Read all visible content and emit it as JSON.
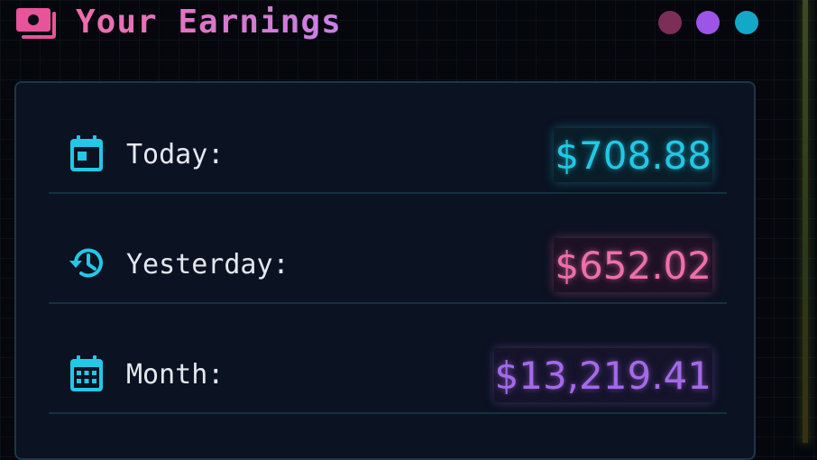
{
  "header": {
    "title": "Your Earnings",
    "icon": "money-icon",
    "window_dots": [
      {
        "name": "window-dot-magenta",
        "color": "#7c2e58"
      },
      {
        "name": "window-dot-purple",
        "color": "#9c55e6"
      },
      {
        "name": "window-dot-cyan",
        "color": "#12a8c8"
      }
    ]
  },
  "earnings": {
    "today": {
      "label": "Today:",
      "value": "$708.88",
      "icon": "calendar-today-icon",
      "color": "#22c8e6"
    },
    "yesterday": {
      "label": "Yesterday:",
      "value": "$652.02",
      "icon": "history-icon",
      "color": "#ee6fa9"
    },
    "month": {
      "label": "Month:",
      "value": "$13,219.41",
      "icon": "calendar-month-icon",
      "color": "#a46ae8"
    }
  },
  "colors": {
    "background": "#05070c",
    "card": "#0b1221",
    "card_border": "#1c3648",
    "label_text": "#e4e8f0",
    "icon_cyan": "#22c8e6",
    "title_gradient_start": "#f06cab",
    "title_gradient_end": "#c781e6"
  }
}
